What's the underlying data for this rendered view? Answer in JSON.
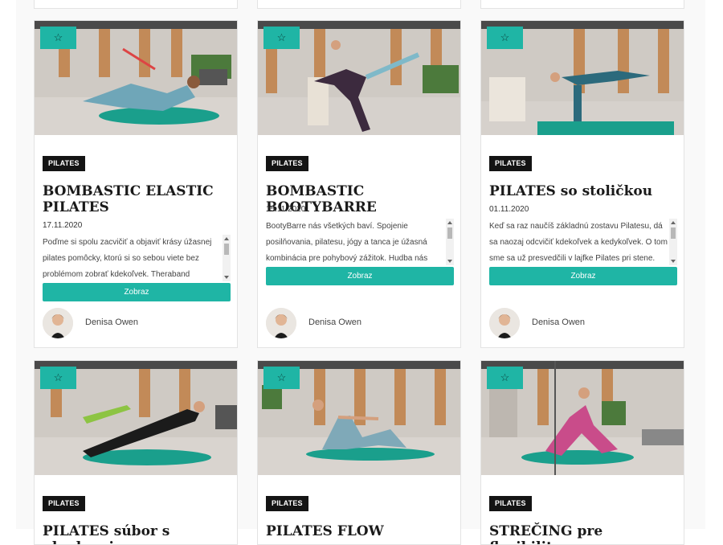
{
  "cards": [
    {
      "category": "PILATES",
      "title": "BOMBASTIC ELASTIC PILATES",
      "date": "17.11.2020",
      "excerpt": "Poďme si spolu zacvičiť a objaviť krásy úžasnej pilates pomôcky, ktorú si so sebou viete bez problémom zobrať kdekoľvek. Theraband",
      "button": "Zobraz",
      "author": "Denisa Owen",
      "fav_icon": "☆"
    },
    {
      "category": "PILATES",
      "title": "BOMBASTIC BOOTYBARRE",
      "date": "15.11.2020",
      "excerpt": "BootyBarre nás všetkých baví. Spojenie posilňovania, pilatesu, jógy a tanca je úžasná kombinácia pre pohybový zážitok. Hudba nás krásne naštartuje a",
      "button": "Zobraz",
      "author": "Denisa Owen",
      "fav_icon": "☆"
    },
    {
      "category": "PILATES",
      "title": "PILATES so stoličkou",
      "date": "01.11.2020",
      "excerpt": "Keď sa raz naučíš základnú zostavu Pilatesu, dá sa naozaj odcvičiť kdekoľvek a kedykoľvek. O tom sme sa už presvedčili v lajfke Pilates pri stene. Dnes",
      "button": "Zobraz",
      "author": "Denisa Owen",
      "fav_icon": "☆"
    },
    {
      "category": "PILATES",
      "title": "PILATES súbor s plankami",
      "fav_icon": "☆"
    },
    {
      "category": "PILATES",
      "title": "PILATES FLOW",
      "fav_icon": "☆"
    },
    {
      "category": "PILATES",
      "title": "STREČING pre flexibilitu a",
      "fav_icon": "☆"
    }
  ],
  "colors": {
    "accent": "#1fb5a5",
    "category_bg": "#141414",
    "mat": "#1a9f8c"
  }
}
